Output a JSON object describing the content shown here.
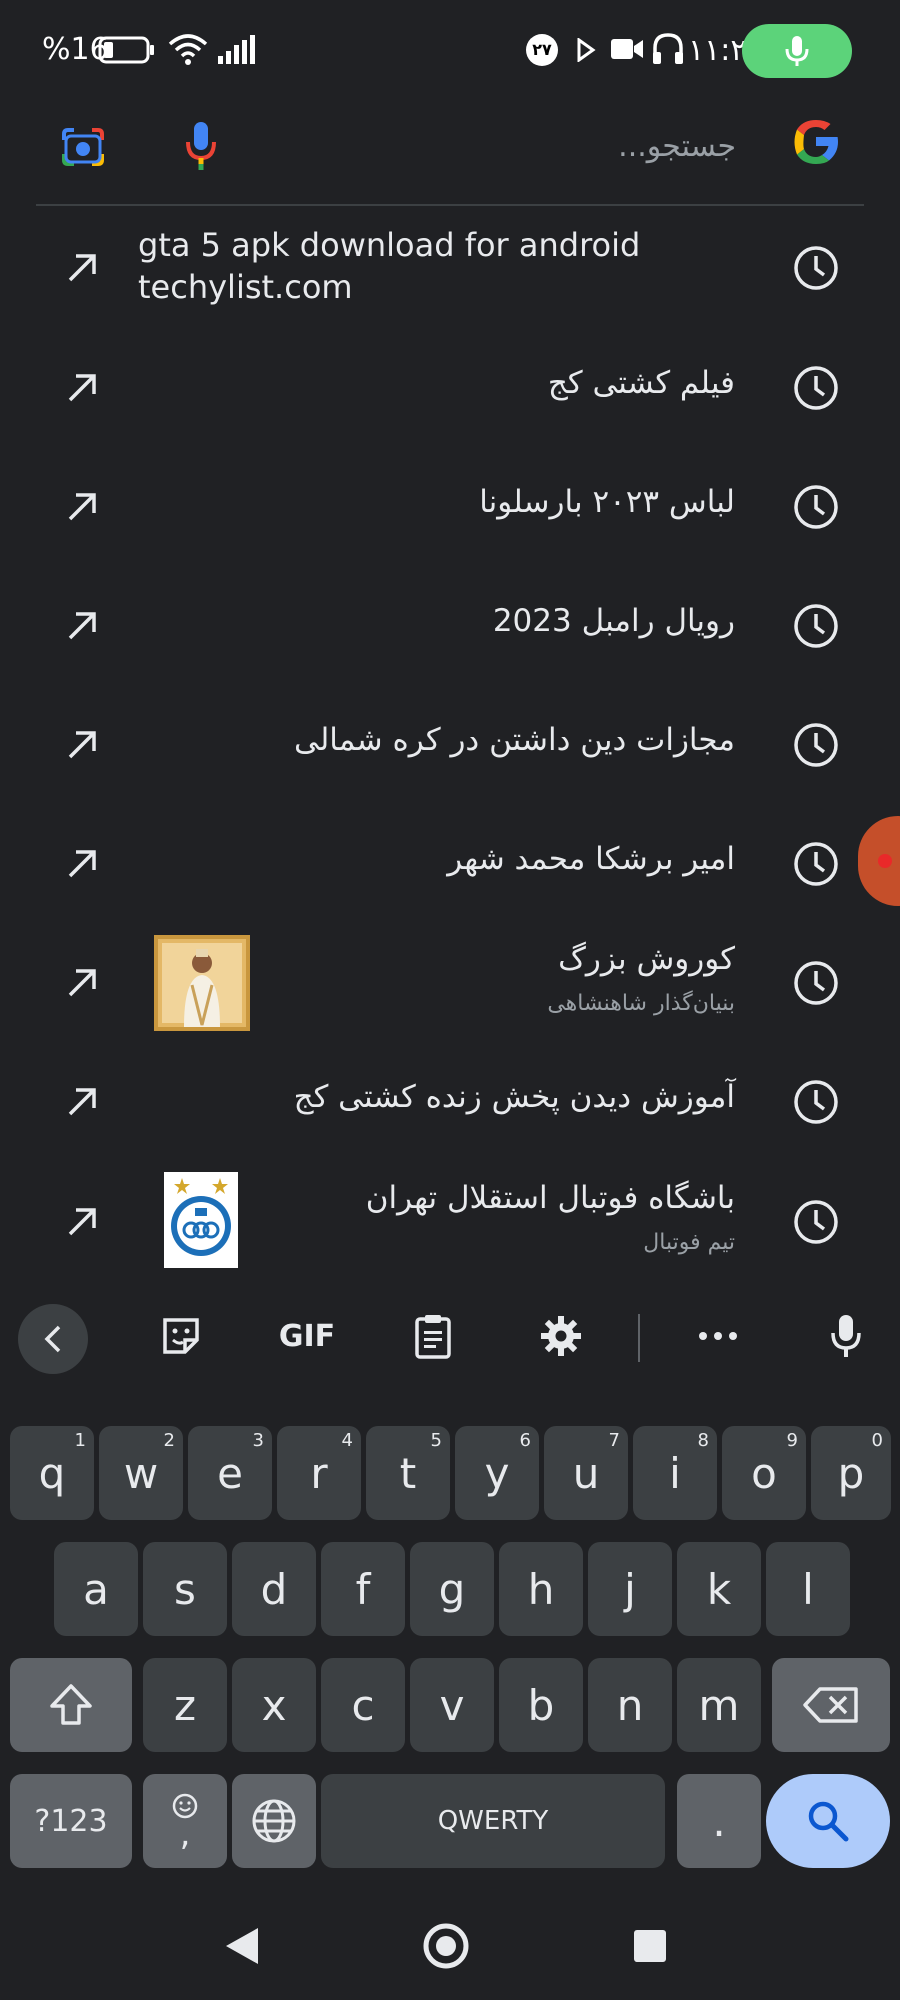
{
  "status_bar": {
    "battery_percent": "%16",
    "notification_badge": "۲۷",
    "time": "۱۱:۲۱",
    "mic_pill_color": "#5cd37a",
    "icons": [
      "battery-icon",
      "wifi-icon",
      "signal-icon",
      "badge-icon",
      "play-icon",
      "video-icon",
      "headphones-icon",
      "mic-icon"
    ]
  },
  "search": {
    "placeholder": "جستجو...",
    "icons": [
      "google-logo",
      "mic-icon",
      "lens-camera-icon"
    ]
  },
  "suggestions": [
    {
      "lines": [
        "gta 5 apk download for android",
        "techylist.com"
      ],
      "subtitle": "",
      "thumbnail": null
    },
    {
      "title": "فیلم کشتی کج",
      "subtitle": "",
      "thumbnail": null
    },
    {
      "title": "لباس ۲۰۲۳ بارسلونا",
      "subtitle": "",
      "thumbnail": null
    },
    {
      "title": "رویال رامبل 2023",
      "subtitle": "",
      "thumbnail": null
    },
    {
      "title": "مجازات دین داشتن در کره شمالی",
      "subtitle": "",
      "thumbnail": null
    },
    {
      "title": "امیر برشکا محمد شهر",
      "subtitle": "",
      "thumbnail": null
    },
    {
      "title": "کوروش بزرگ",
      "subtitle": "بنیان‌گذار شاهنشاهی",
      "thumbnail": "portrait"
    },
    {
      "title": "آموزش دیدن پخش زنده کشتی کج",
      "subtitle": "",
      "thumbnail": null
    },
    {
      "title": "باشگاه فوتبال استقلال تهران",
      "subtitle": "تیم فوتبال",
      "thumbnail": "club-logo"
    }
  ],
  "keyboard": {
    "toolbar": {
      "gif_label": "GIF",
      "icons": [
        "back-chevron-icon",
        "sticker-icon",
        "gif-icon",
        "clipboard-icon",
        "settings-gear-icon",
        "more-dots-icon",
        "mic-icon"
      ]
    },
    "row1": [
      {
        "key": "q",
        "hint": "1"
      },
      {
        "key": "w",
        "hint": "2"
      },
      {
        "key": "e",
        "hint": "3"
      },
      {
        "key": "r",
        "hint": "4"
      },
      {
        "key": "t",
        "hint": "5"
      },
      {
        "key": "y",
        "hint": "6"
      },
      {
        "key": "u",
        "hint": "7"
      },
      {
        "key": "i",
        "hint": "8"
      },
      {
        "key": "o",
        "hint": "9"
      },
      {
        "key": "p",
        "hint": "0"
      }
    ],
    "row2": [
      "a",
      "s",
      "d",
      "f",
      "g",
      "h",
      "j",
      "k",
      "l"
    ],
    "row3": [
      "z",
      "x",
      "c",
      "v",
      "b",
      "n",
      "m"
    ],
    "row4": {
      "symbols_label": "?123",
      "comma_label": ",",
      "space_label": "QWERTY",
      "period_label": "."
    },
    "search_key_color": "#aecbfa"
  },
  "nav_bar": {
    "icons": [
      "back-triangle-icon",
      "home-circle-icon",
      "recents-square-icon"
    ]
  }
}
